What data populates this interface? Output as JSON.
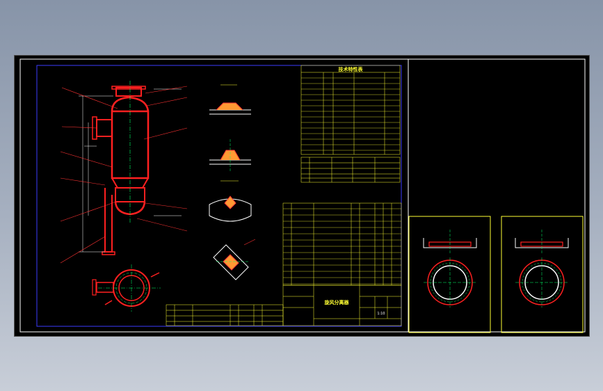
{
  "drawing": {
    "title_block": {
      "title": "旋风分离器",
      "subtitle": "",
      "scale": "1:10"
    },
    "tech_table_title": "技术特性表",
    "colors": {
      "background": "#000000",
      "frame": "#ffffff",
      "sheet_border": "#3b3bff",
      "table_lines": "#ffff33",
      "vessel": "#ff2020",
      "dimension": "#ffffff",
      "centerline": "#00ff66",
      "leader": "#ff3333",
      "hatch": "#ff9933"
    },
    "views": [
      {
        "name": "front-view",
        "label": ""
      },
      {
        "name": "top-view",
        "label": ""
      },
      {
        "name": "weld-detail-1",
        "label": ""
      },
      {
        "name": "weld-detail-2",
        "label": ""
      },
      {
        "name": "weld-detail-3",
        "label": ""
      },
      {
        "name": "weld-detail-4",
        "label": ""
      },
      {
        "name": "flange-view-left",
        "label": ""
      },
      {
        "name": "flange-view-right",
        "label": ""
      }
    ]
  }
}
